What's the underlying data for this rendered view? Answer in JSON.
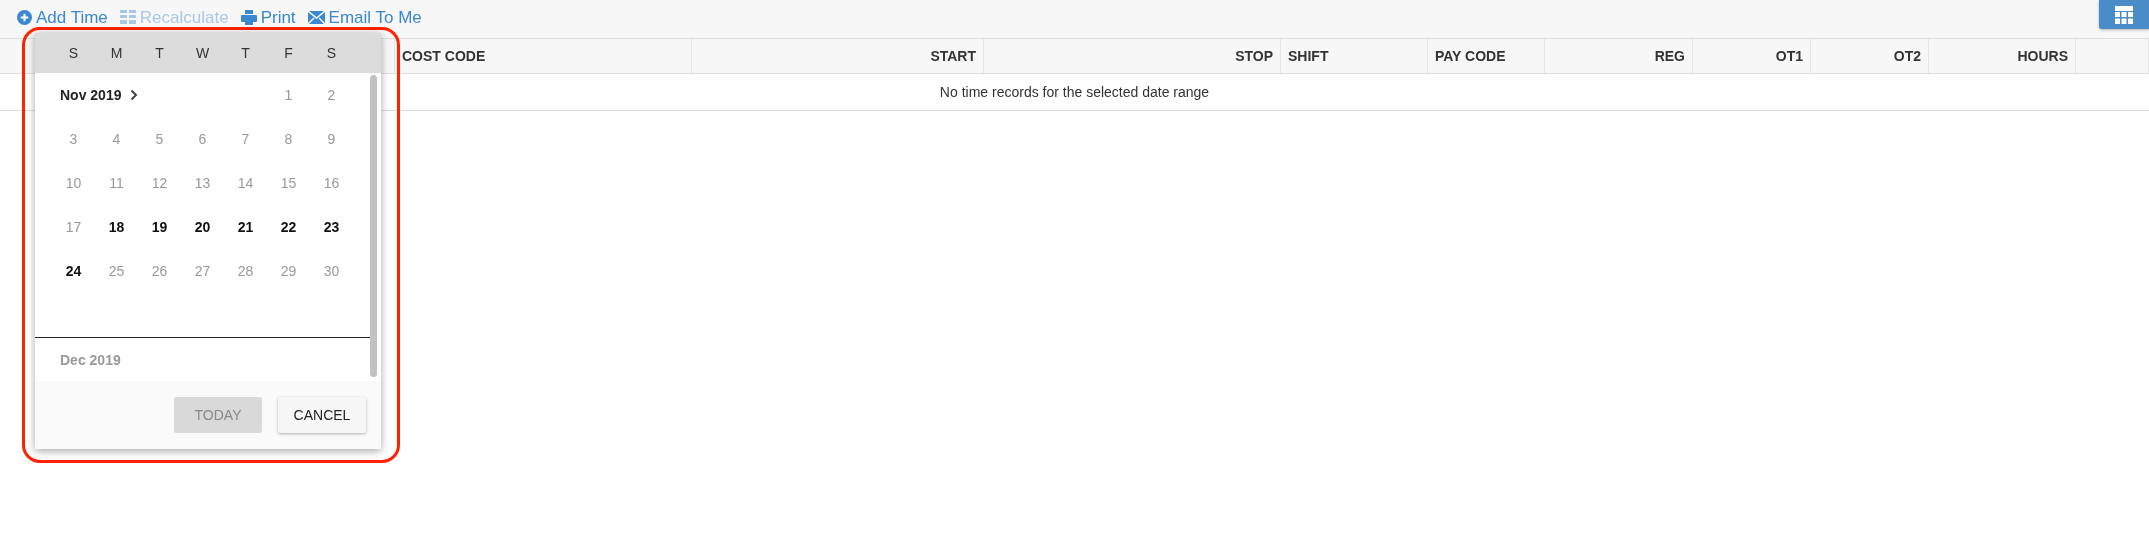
{
  "toolbar": [
    {
      "kind": "add",
      "label": "Add Time",
      "disabled": false
    },
    {
      "kind": "recalculate",
      "label": "Recalculate",
      "disabled": true
    },
    {
      "kind": "print",
      "label": "Print",
      "disabled": false
    },
    {
      "kind": "email",
      "label": "Email To Me",
      "disabled": false
    }
  ],
  "table": {
    "columns": [
      {
        "kind": "blank"
      },
      {
        "kind": "text",
        "label": "COST CODE"
      },
      {
        "kind": "numeric",
        "label": "START"
      },
      {
        "kind": "numeric",
        "label": "STOP"
      },
      {
        "kind": "text",
        "label": "SHIFT"
      },
      {
        "kind": "text",
        "label": "PAY CODE"
      },
      {
        "kind": "numeric",
        "label": "REG"
      },
      {
        "kind": "numeric",
        "label": "OT1"
      },
      {
        "kind": "numeric",
        "label": "OT2"
      },
      {
        "kind": "numeric",
        "label": "HOURS"
      },
      {
        "kind": "blank"
      }
    ],
    "empty_message": "No time records for the selected date range"
  },
  "calendar": {
    "weekdays": [
      "S",
      "M",
      "T",
      "W",
      "T",
      "F",
      "S"
    ],
    "months": [
      {
        "label": "Nov 2019",
        "current": true,
        "next_arrow": true,
        "weeks": [
          {
            "days": [
              {
                "label": "1",
                "available": false
              },
              {
                "label": "2",
                "available": false
              }
            ]
          },
          {
            "days": [
              {
                "label": "3",
                "available": false
              },
              {
                "label": "4",
                "available": false
              },
              {
                "label": "5",
                "available": false
              },
              {
                "label": "6",
                "available": false
              },
              {
                "label": "7",
                "available": false
              },
              {
                "label": "8",
                "available": false
              },
              {
                "label": "9",
                "available": false
              }
            ]
          },
          {
            "days": [
              {
                "label": "10",
                "available": false
              },
              {
                "label": "11",
                "available": false
              },
              {
                "label": "12",
                "available": false
              },
              {
                "label": "13",
                "available": false
              },
              {
                "label": "14",
                "available": false
              },
              {
                "label": "15",
                "available": false
              },
              {
                "label": "16",
                "available": false
              }
            ]
          },
          {
            "days": [
              {
                "label": "17",
                "available": false
              },
              {
                "label": "18",
                "available": true
              },
              {
                "label": "19",
                "available": true
              },
              {
                "label": "20",
                "available": true
              },
              {
                "label": "21",
                "available": true
              },
              {
                "label": "22",
                "available": true
              },
              {
                "label": "23",
                "available": true
              }
            ]
          },
          {
            "days": [
              {
                "label": "24",
                "available": true
              },
              {
                "label": "25",
                "available": false
              },
              {
                "label": "26",
                "available": false
              },
              {
                "label": "27",
                "available": false
              },
              {
                "label": "28",
                "available": false
              },
              {
                "label": "29",
                "available": false
              },
              {
                "label": "30",
                "available": false
              }
            ]
          }
        ]
      },
      {
        "label": "Dec 2019",
        "current": false,
        "next_arrow": false
      }
    ],
    "buttons": [
      {
        "label": "TODAY",
        "disabled": true
      },
      {
        "label": "CANCEL",
        "disabled": false
      }
    ]
  }
}
